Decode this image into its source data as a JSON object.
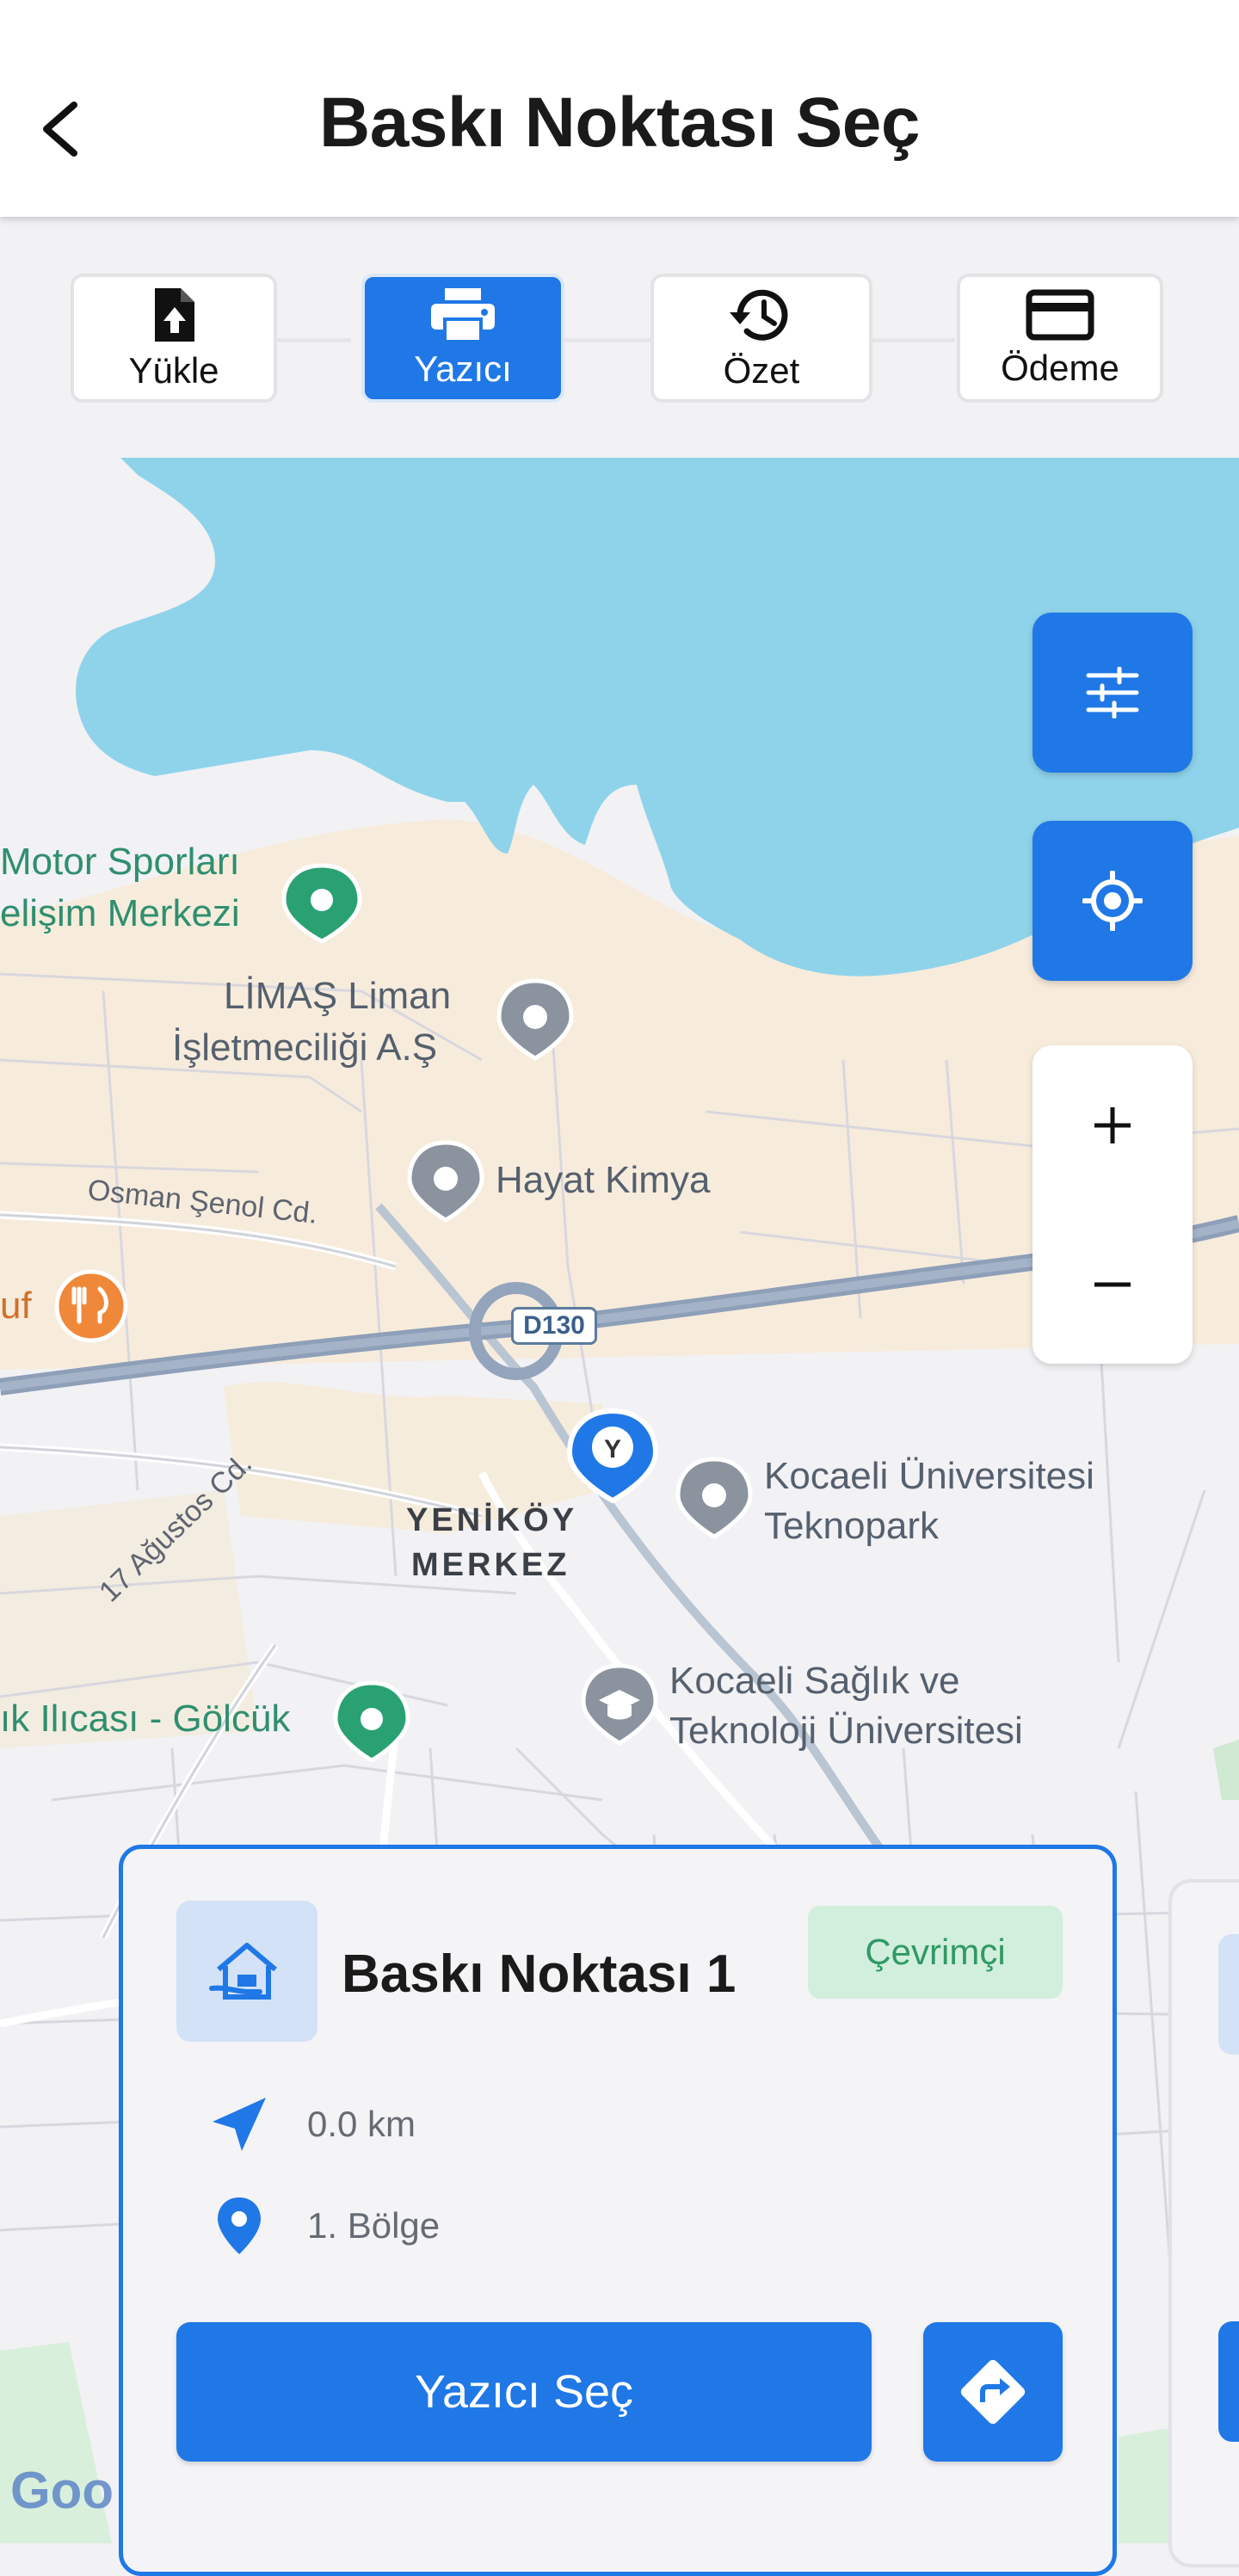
{
  "header": {
    "title": "Baskı Noktası Seç",
    "back_icon": "chevron-left-icon"
  },
  "stepper": {
    "steps": [
      {
        "label": "Yükle",
        "icon": "upload-icon",
        "active": false
      },
      {
        "label": "Yazıcı",
        "icon": "printer-icon",
        "active": true
      },
      {
        "label": "Özet",
        "icon": "history-icon",
        "active": false
      },
      {
        "label": "Ödeme",
        "icon": "credit-card-icon",
        "active": false
      }
    ]
  },
  "map": {
    "labels": {
      "motor_line1": "Motor Sporları",
      "motor_line2": "elişim Merkezi",
      "limas_line1": "LİMAŞ Liman",
      "limas_line2": "İşletmeciliği A.Ş",
      "hayat": "Hayat Kimya",
      "osman": "Osman Şenol Cd.",
      "uf": "uf",
      "road": "D130",
      "agustos": "17 Ağustos Cd.",
      "yenikoy_line1": "YENİKÖY",
      "yenikoy_line2": "MERKEZ",
      "teknopark_line1": "Kocaeli Üniversitesi",
      "teknopark_line2": "Teknopark",
      "ilica": "ık Ilıcası - Gölcük",
      "saglik_line1": "Kocaeli Sağlık ve",
      "saglik_line2": "Teknoloji Üniversitesi",
      "google": "Goo"
    },
    "controls": {
      "filter_icon": "sliders-icon",
      "locate_icon": "crosshair-icon",
      "zoom_in": "+",
      "zoom_out": "−"
    }
  },
  "card": {
    "title": "Baskı Noktası 1",
    "status": "Çevrimçi",
    "distance": "0.0 km",
    "region": "1. Bölge",
    "select_label": "Yazıcı Seç",
    "directions_icon": "directions-icon"
  },
  "colors": {
    "accent": "#1f78e6",
    "water": "#8fd3ea",
    "online_bg": "#d2eedd",
    "online_text": "#2f9a64"
  }
}
